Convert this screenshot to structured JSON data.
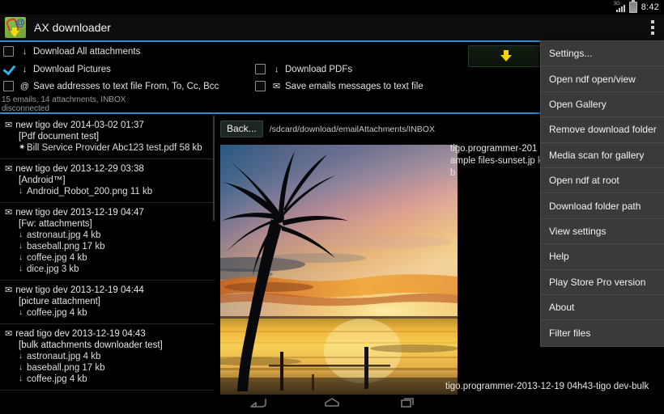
{
  "statusbar": {
    "network_label": "3G",
    "clock": "8:42"
  },
  "actionbar": {
    "app_title": "AX downloader",
    "overflow_name": "overflow-menu"
  },
  "options": {
    "rows": [
      {
        "label": "Download All attachments",
        "glyph": "↓",
        "checked": false
      },
      {
        "label": "Download Pictures",
        "glyph": "↓",
        "checked": true
      },
      {
        "label": "Save addresses to text file From, To, Cc, Bcc",
        "glyph": "@",
        "checked": false
      },
      {
        "label": "Download PDFs",
        "glyph": "↓",
        "checked": false
      },
      {
        "label": "Save emails messages to text file",
        "glyph": "✉",
        "checked": false
      }
    ],
    "download_button": "download-arrow",
    "status_line_1": "15 emails, 14 attachments, INBOX",
    "status_line_2": "disconnected"
  },
  "maillist": [
    {
      "state": "new",
      "header": "new tigo dev 2014-03-02 01:37",
      "subject": "[Pdf document test]",
      "attachments": [
        {
          "glyph": "✷",
          "name": "Bill Service Provider Abc123 test.pdf 58 kb"
        }
      ]
    },
    {
      "state": "new",
      "header": "new tigo dev 2013-12-29 03:38",
      "subject": "[Android™]",
      "attachments": [
        {
          "glyph": "↓",
          "name": "Android_Robot_200.png 11 kb"
        }
      ]
    },
    {
      "state": "new",
      "header": "new tigo dev 2013-12-19 04:47",
      "subject": "[Fw: attachments]",
      "attachments": [
        {
          "glyph": "↓",
          "name": "astronaut.jpg 4 kb"
        },
        {
          "glyph": "↓",
          "name": "baseball.png 17 kb"
        },
        {
          "glyph": "↓",
          "name": "coffee.jpg 4 kb"
        },
        {
          "glyph": "↓",
          "name": "dice.jpg 3 kb"
        }
      ]
    },
    {
      "state": "new",
      "header": "new tigo dev 2013-12-19 04:44",
      "subject": "[picture attachment]",
      "attachments": [
        {
          "glyph": "↓",
          "name": "coffee.jpg 4 kb"
        }
      ]
    },
    {
      "state": "read",
      "header": "read tigo dev 2013-12-19 04:43",
      "subject": "[bulk attachments downloader test]",
      "attachments": [
        {
          "glyph": "↓",
          "name": "astronaut.jpg 4 kb"
        },
        {
          "glyph": "↓",
          "name": "baseball.png 17 kb"
        },
        {
          "glyph": "↓",
          "name": "coffee.jpg 4 kb"
        }
      ]
    }
  ],
  "viewer": {
    "back_label": "Back...",
    "path": "/sdcard/download/emailAttachments/INBOX",
    "side_caption": "tigo.programmer-201 sample files-sunset.jp kb",
    "bottom_caption": "tigo.programmer-2013-12-19 04h43-tigo dev-bulk",
    "image_alt": "sunset-beach-palm-tree-photo"
  },
  "menu": {
    "items": [
      "Settings...",
      "Open ndf open/view",
      "Open Gallery",
      "Remove download folder",
      "Media scan for gallery",
      "Open ndf at root",
      "Download folder path",
      "View settings",
      "Help",
      "Play Store Pro version",
      "About",
      "Filter files"
    ]
  },
  "navbar": {
    "back": "back-icon",
    "home": "home-icon",
    "recents": "recents-icon"
  },
  "colors": {
    "accent_blue": "#2d8fd0",
    "checkbox_checked": "#29b6e8",
    "menu_bg": "#3a3a3a",
    "download_arrow": "#f2d600"
  }
}
